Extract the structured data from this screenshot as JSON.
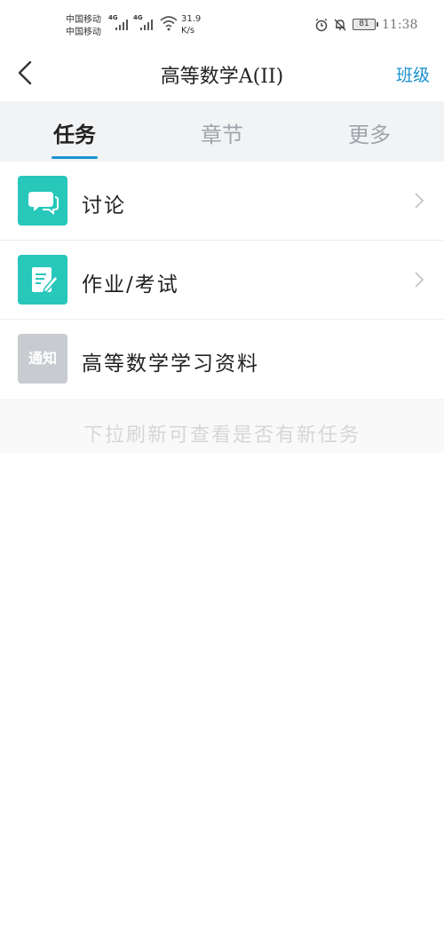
{
  "statusbar": {
    "carrier1": "中国移动",
    "carrier2": "中国移动",
    "net1": "4G",
    "net2": "4G",
    "speed_value": "31.9",
    "speed_unit": "K/s",
    "battery": "81",
    "time": "11:38",
    "icons": [
      "alarm-icon",
      "mute-icon"
    ]
  },
  "navbar": {
    "title": "高等数学A(II)",
    "right_label": "班级"
  },
  "tabs": [
    {
      "label": "任务",
      "active": true
    },
    {
      "label": "章节",
      "active": false
    },
    {
      "label": "更多",
      "active": false
    }
  ],
  "list": [
    {
      "label": "讨论",
      "icon": "chat-bubble-icon",
      "color": "#27c7ba"
    },
    {
      "label": "作业/考试",
      "icon": "edit-document-icon",
      "color": "#27c7ba"
    },
    {
      "label": "高等数学学习资料",
      "icon": "notice-icon",
      "icon_text": "通知",
      "color": "#c8cbd0"
    }
  ],
  "hint": "下拉刷新可查看是否有新任务",
  "colors": {
    "accent": "#1c92d2",
    "teal": "#27c7ba"
  }
}
